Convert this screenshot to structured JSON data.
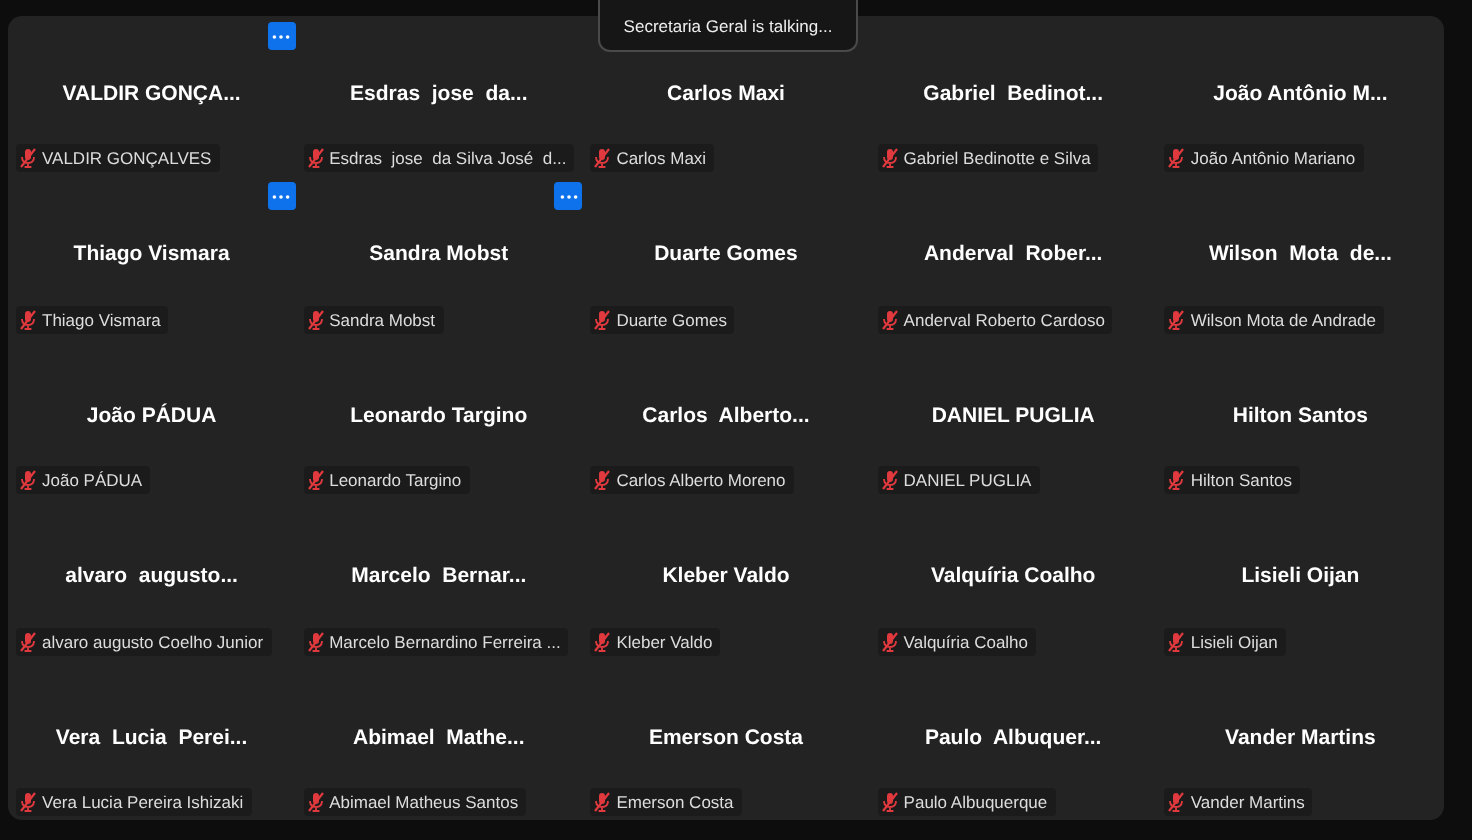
{
  "toast": {
    "text": "Secretaria Geral is talking..."
  },
  "tiles": [
    {
      "display_name": "VALDIR GONÇA...",
      "label": "VALDIR GONÇALVES",
      "muted": true,
      "menu_button": true
    },
    {
      "display_name": "Esdras  jose  da...",
      "label": "Esdras  jose  da Silva José  d...",
      "muted": true,
      "menu_button": false
    },
    {
      "display_name": "Carlos Maxi",
      "label": "Carlos Maxi",
      "muted": true,
      "menu_button": false
    },
    {
      "display_name": "Gabriel  Bedinot...",
      "label": "Gabriel Bedinotte e Silva",
      "muted": true,
      "menu_button": false
    },
    {
      "display_name": "João Antônio M...",
      "label": "João Antônio Mariano",
      "muted": true,
      "menu_button": false
    },
    {
      "display_name": "Thiago Vismara",
      "label": "Thiago Vismara",
      "muted": true,
      "menu_button": true
    },
    {
      "display_name": "Sandra Mobst",
      "label": "Sandra Mobst",
      "muted": true,
      "menu_button": true
    },
    {
      "display_name": "Duarte Gomes",
      "label": "Duarte Gomes",
      "muted": true,
      "menu_button": false
    },
    {
      "display_name": "Anderval  Rober...",
      "label": "Anderval Roberto Cardoso",
      "muted": true,
      "menu_button": false
    },
    {
      "display_name": "Wilson  Mota  de...",
      "label": "Wilson Mota de Andrade",
      "muted": true,
      "menu_button": false
    },
    {
      "display_name": "João PÁDUA",
      "label": "João PÁDUA",
      "muted": true,
      "menu_button": false
    },
    {
      "display_name": "Leonardo Targino",
      "label": "Leonardo Targino",
      "muted": true,
      "menu_button": false
    },
    {
      "display_name": "Carlos  Alberto...",
      "label": "Carlos Alberto Moreno",
      "muted": true,
      "menu_button": false
    },
    {
      "display_name": "DANIEL PUGLIA",
      "label": "DANIEL PUGLIA",
      "muted": true,
      "menu_button": false
    },
    {
      "display_name": "Hilton Santos",
      "label": "Hilton Santos",
      "muted": true,
      "menu_button": false
    },
    {
      "display_name": "alvaro  augusto...",
      "label": "alvaro augusto Coelho Junior",
      "muted": true,
      "menu_button": false
    },
    {
      "display_name": "Marcelo  Bernar...",
      "label": "Marcelo Bernardino Ferreira ...",
      "muted": true,
      "menu_button": false
    },
    {
      "display_name": "Kleber Valdo",
      "label": "Kleber Valdo",
      "muted": true,
      "menu_button": false
    },
    {
      "display_name": "Valquíria Coalho",
      "label": "Valquíria Coalho",
      "muted": true,
      "menu_button": false
    },
    {
      "display_name": "Lisieli Oijan",
      "label": "Lisieli Oijan",
      "muted": true,
      "menu_button": false
    },
    {
      "display_name": "Vera  Lucia  Perei...",
      "label": "Vera Lucia Pereira Ishizaki",
      "muted": true,
      "menu_button": false
    },
    {
      "display_name": "Abimael  Mathe...",
      "label": "Abimael Matheus Santos",
      "muted": true,
      "menu_button": false
    },
    {
      "display_name": "Emerson Costa",
      "label": "Emerson Costa",
      "muted": true,
      "menu_button": false
    },
    {
      "display_name": "Paulo  Albuquer...",
      "label": "Paulo Albuquerque",
      "muted": true,
      "menu_button": false
    },
    {
      "display_name": "Vander Martins",
      "label": "Vander Martins",
      "muted": true,
      "menu_button": false
    }
  ]
}
